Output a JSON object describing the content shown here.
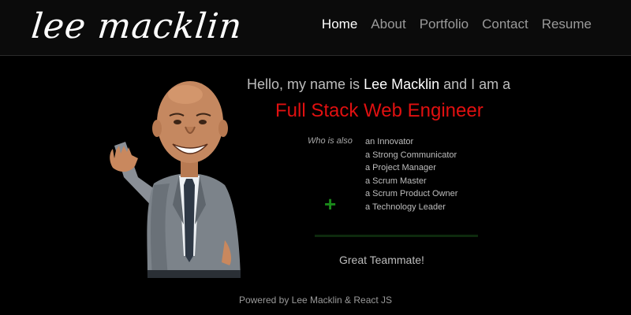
{
  "header": {
    "logo_text": "lee macklin",
    "nav": [
      {
        "label": "Home",
        "active": true
      },
      {
        "label": "About",
        "active": false
      },
      {
        "label": "Portfolio",
        "active": false
      },
      {
        "label": "Contact",
        "active": false
      },
      {
        "label": "Resume",
        "active": false
      }
    ]
  },
  "hero": {
    "greeting_prefix": "Hello, my name is",
    "name": "Lee Macklin",
    "greeting_suffix": "and I am a",
    "role": "Full Stack Web Engineer",
    "who_label": "Who is also",
    "traits": [
      "an Innovator",
      "a Strong Communicator",
      "a Project Manager",
      "a Scrum Master",
      "a Scrum Product Owner",
      "a Technology Leader"
    ],
    "plus_icon": "+",
    "closing": "Great Teammate!"
  },
  "footer": {
    "text": "Powered by Lee Macklin & React JS"
  },
  "colors": {
    "background": "#000000",
    "accent_red": "#e01010",
    "accent_green": "#1a8a1a",
    "nav_active": "#ffffff",
    "nav_inactive": "#9a9a9a"
  }
}
